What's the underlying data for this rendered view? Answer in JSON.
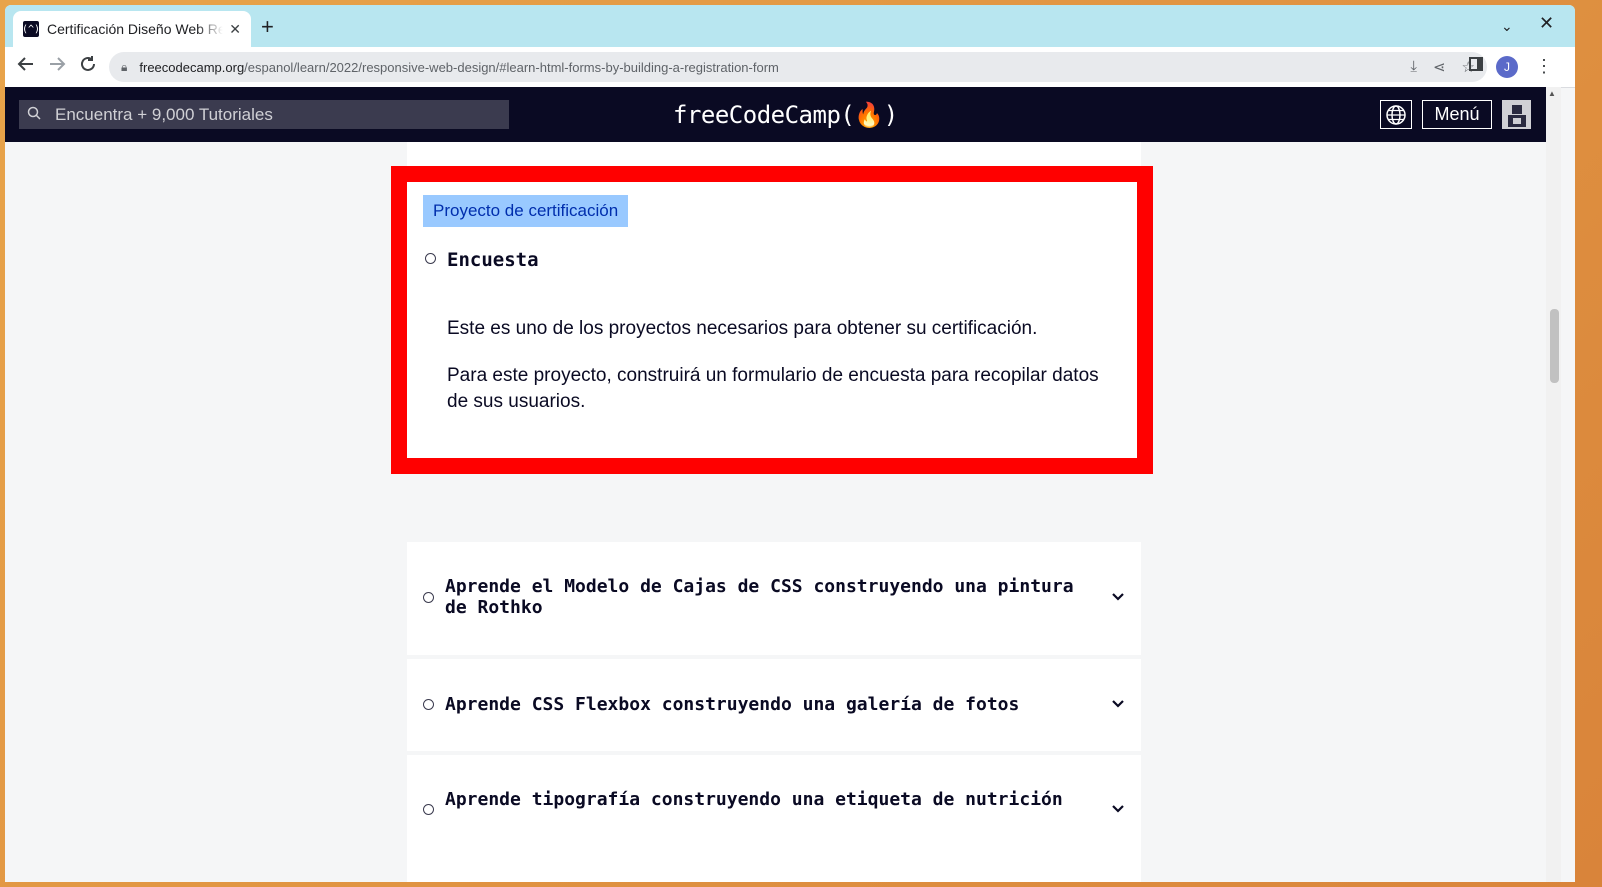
{
  "browser": {
    "tab_title": "Certificación Diseño Web Responsivo",
    "tab_favicon": "(^)",
    "url_host": "freecodecamp.org",
    "url_path": "/espanol/learn/2022/responsive-web-design/#learn-html-forms-by-building-a-registration-form",
    "profile_initial": "J",
    "icons": [
      "back-icon",
      "forward-icon",
      "reload-icon",
      "lock-icon",
      "install-icon",
      "share-icon",
      "star-icon",
      "side-panel-icon",
      "kebab-menu-icon"
    ]
  },
  "site_header": {
    "search_placeholder": "Encuentra + 9,000 Tutoriales",
    "logo": "freeCodeCamp(🔥)",
    "menu_label": "Menú"
  },
  "cert_project": {
    "badge": "Proyecto de certificación",
    "title": "Encuesta",
    "paragraphs": [
      "Este es uno de los proyectos necesarios para obtener su certificación.",
      "Para este proyecto, construirá un formulario de encuesta para recopilar datos de sus usuarios."
    ]
  },
  "blocks": [
    {
      "title": "Aprende el Modelo de Cajas de CSS construyendo una pintura de Rothko"
    },
    {
      "title": "Aprende CSS Flexbox construyendo una galería de fotos"
    },
    {
      "title": "Aprende tipografía construyendo una etiqueta de nutrición"
    }
  ],
  "colors": {
    "header_bg": "#0a0a23",
    "highlight_border": "#ff0000",
    "badge_bg": "#99c9ff",
    "badge_text": "#002ead",
    "tabstrip_bg": "#b8e6f0"
  }
}
